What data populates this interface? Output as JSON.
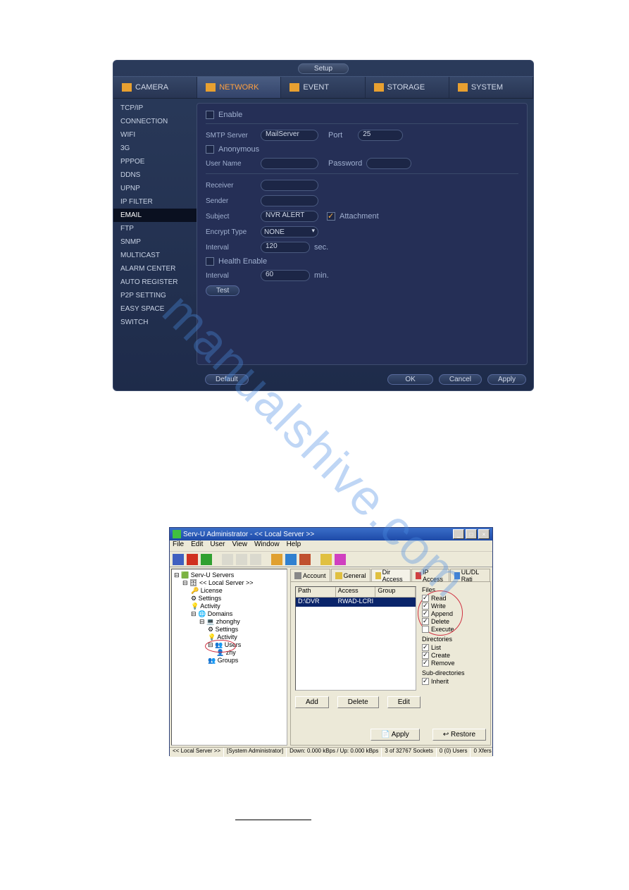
{
  "watermark": "manualshive.com",
  "nvr": {
    "title": "Setup",
    "tabs": [
      "CAMERA",
      "NETWORK",
      "EVENT",
      "STORAGE",
      "SYSTEM"
    ],
    "active_tab": "NETWORK",
    "sidebar": [
      "TCP/IP",
      "CONNECTION",
      "WIFI",
      "3G",
      "PPPOE",
      "DDNS",
      "UPNP",
      "IP FILTER",
      "EMAIL",
      "FTP",
      "SNMP",
      "MULTICAST",
      "ALARM CENTER",
      "AUTO REGISTER",
      "P2P SETTING",
      "EASY SPACE",
      "SWITCH"
    ],
    "sidebar_selected": "EMAIL",
    "fields": {
      "enable_label": "Enable",
      "smtp_server_label": "SMTP Server",
      "smtp_server_value": "MailServer",
      "port_label": "Port",
      "port_value": "25",
      "anon_label": "Anonymous",
      "username_label": "User Name",
      "username_value": "",
      "password_label": "Password",
      "password_value": "",
      "receiver_label": "Receiver",
      "receiver_value": "",
      "sender_label": "Sender",
      "sender_value": "",
      "subject_label": "Subject",
      "subject_value": "NVR ALERT",
      "attach_label": "Attachment",
      "encrypt_label": "Encrypt Type",
      "encrypt_value": "NONE",
      "interval1_label": "Interval",
      "interval1_value": "120",
      "interval1_unit": "sec.",
      "health_label": "Health Enable",
      "interval2_label": "Interval",
      "interval2_value": "60",
      "interval2_unit": "min.",
      "test_btn": "Test"
    },
    "footer": {
      "default_btn": "Default",
      "ok_btn": "OK",
      "cancel_btn": "Cancel",
      "apply_btn": "Apply"
    }
  },
  "servu": {
    "title": "Serv-U Administrator - << Local Server >>",
    "menu": [
      "File",
      "Edit",
      "User",
      "View",
      "Window",
      "Help"
    ],
    "tree": {
      "root": "Serv-U Servers",
      "local_server": "<< Local Server >>",
      "license": "License",
      "settings": "Settings",
      "activity": "Activity",
      "domains": "Domains",
      "domain1": "zhonghy",
      "d_settings": "Settings",
      "d_activity": "Activity",
      "users": "Users",
      "user1": "zhy",
      "groups": "Groups"
    },
    "tabs": [
      "Account",
      "General",
      "Dir Access",
      "IP Access",
      "UL/DL Rati"
    ],
    "active_tab": "Dir Access",
    "list": {
      "headers": [
        "Path",
        "Access",
        "Group"
      ],
      "row": [
        "D:\\DVR",
        "RWAD-LCRI",
        ""
      ]
    },
    "perms": {
      "files_label": "Files",
      "read": "Read",
      "write": "Write",
      "append": "Append",
      "delete": "Delete",
      "execute": "Execute",
      "dirs_label": "Directories",
      "list": "List",
      "create": "Create",
      "remove": "Remove",
      "subdirs_label": "Sub-directories",
      "inherit": "Inherit"
    },
    "buttons": {
      "add": "Add",
      "delete": "Delete",
      "edit": "Edit",
      "apply": "Apply",
      "restore": "Restore"
    },
    "status": {
      "s1": "<< Local Server >>",
      "s2": "[System Administrator]",
      "s3": "Down: 0.000 kBps / Up: 0.000 kBps",
      "s4": "3 of 32767 Sockets",
      "s5": "0 (0) Users",
      "s6": "0 Xfers"
    }
  }
}
